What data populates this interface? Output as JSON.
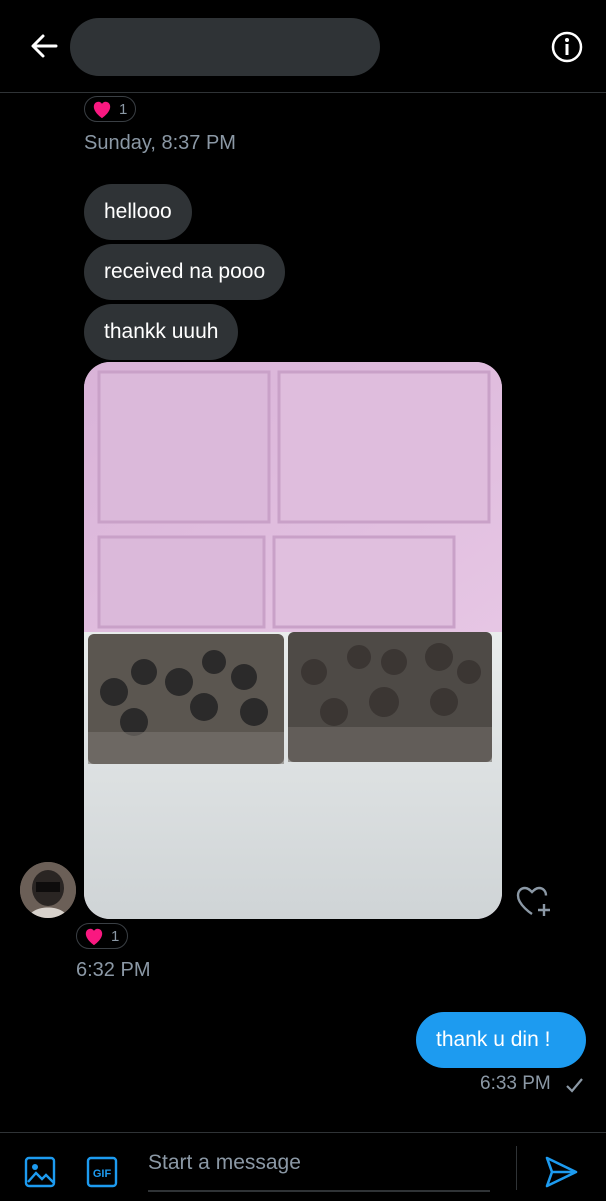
{
  "header": {
    "back_icon": "arrow-left-icon",
    "info_icon": "info-circle-icon"
  },
  "messages": {
    "reaction_top_count": "1",
    "timestamp_top": "Sunday, 8:37 PM",
    "incoming": [
      "hellooo",
      "received na pooo",
      "thankk uuuh"
    ],
    "reaction_photo_count": "1",
    "timestamp_photo": "6:32 PM",
    "outgoing": "thank u din !",
    "timestamp_outgoing": "6:33 PM"
  },
  "composer": {
    "placeholder": "Start a message"
  },
  "colors": {
    "accent": "#1d9bf0",
    "bubble": "#2f3336",
    "heart": "#f91880"
  }
}
